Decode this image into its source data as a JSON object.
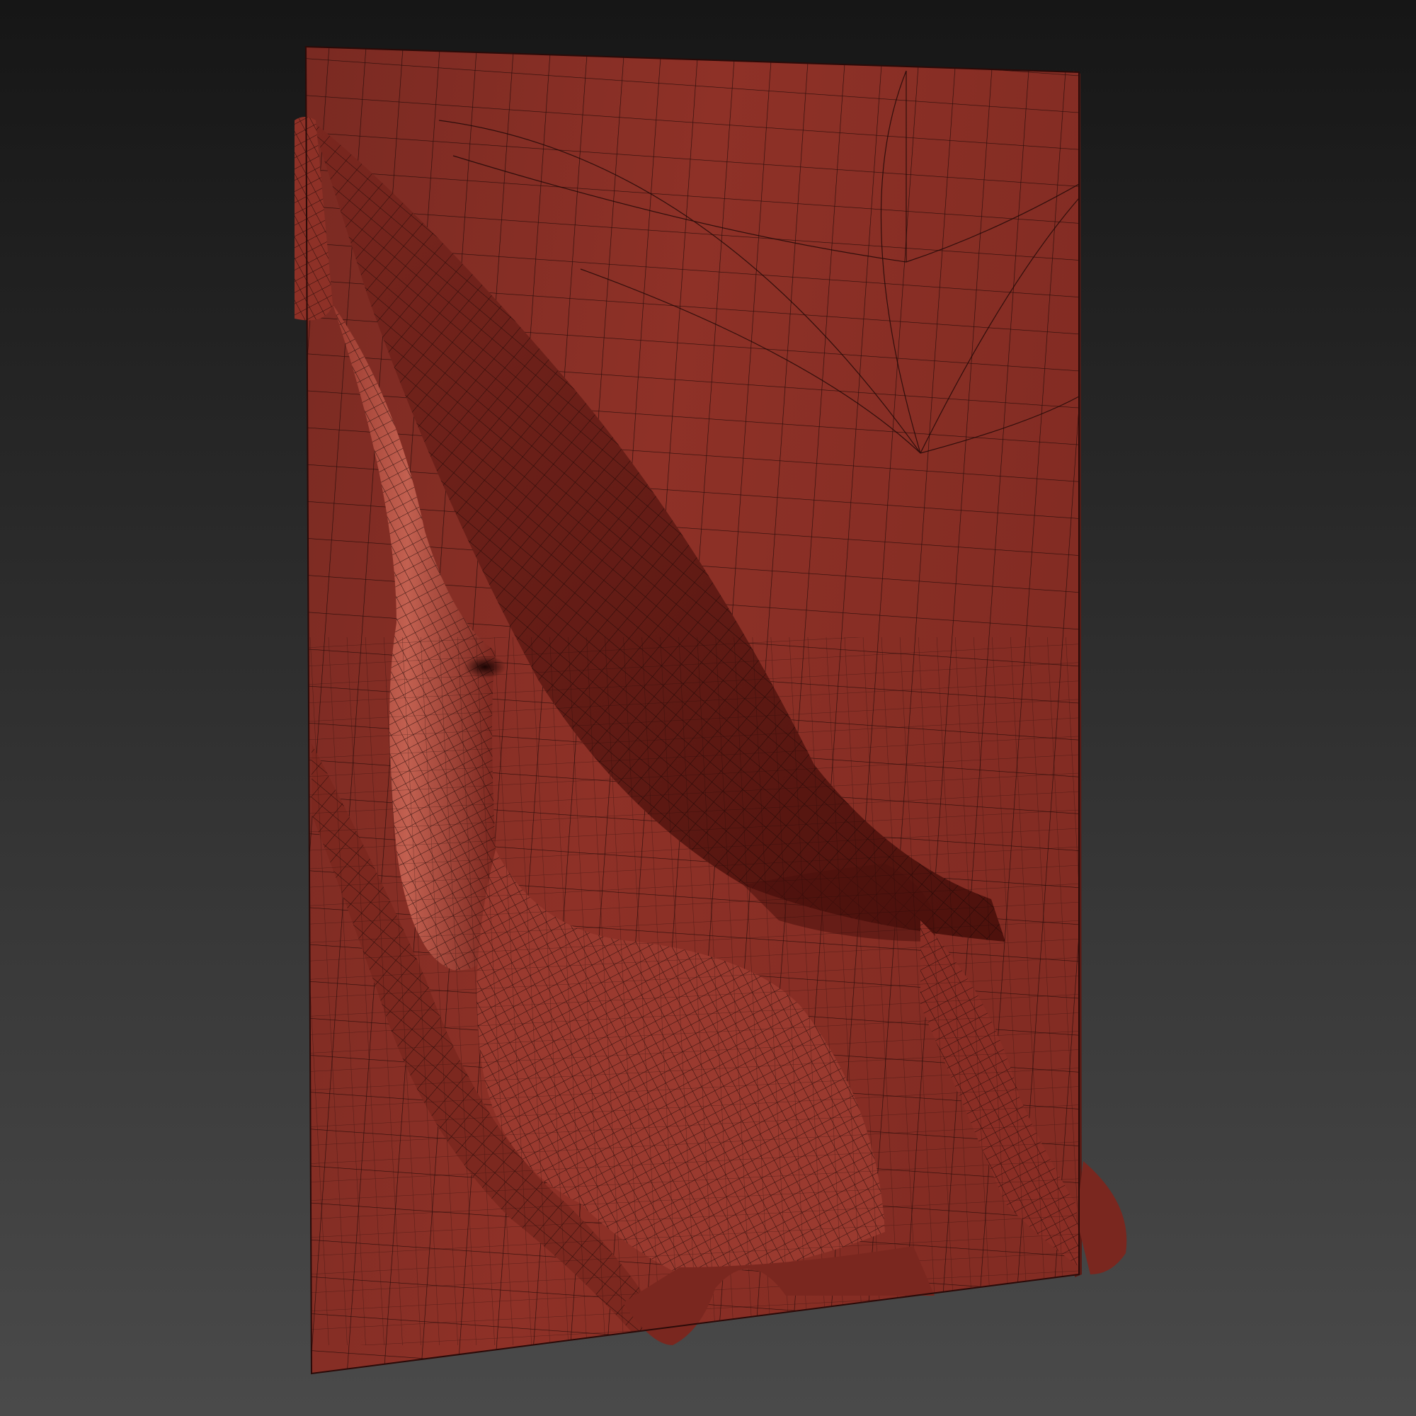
{
  "scene": {
    "subject": "draped-cloth-relief-panel",
    "render_mode": "wireframe-on-shaded",
    "colors": {
      "background_top": "#161616",
      "background_bottom": "#4a4a4a",
      "surface_base": "#8a2e25",
      "surface_highlight": "#b04a3c",
      "surface_shadow": "#4a100c",
      "wire": "#1a0605"
    }
  }
}
